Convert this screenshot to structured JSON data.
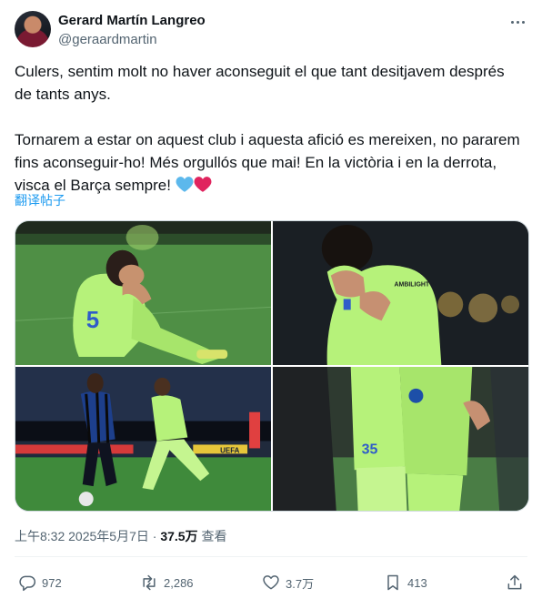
{
  "author": {
    "display_name": "Gerard Martín Langreo",
    "handle": "@geraardmartin"
  },
  "tweet": {
    "paragraph_1": "Culers, sentim molt no haver aconseguit el que tant desitjavem després de tants anys.",
    "paragraph_2": "Tornarem a estar on aquest club i aquesta afició es mereixen, no pararem fins aconseguir-ho! Més orgullós que mai! En la victòria i en la derrota, visca el Barça sempre!",
    "translate_label": "翻译帖子"
  },
  "media": {
    "photo_1_number": "5",
    "photo_2_sponsor": "AMBILIGHT tv",
    "photo_3_board": "UEFA",
    "photo_4_number": "35"
  },
  "meta": {
    "time": "上午8:32",
    "separator": "·",
    "date": "2025年5月7日",
    "views_count": "37.5万",
    "views_label": "查看"
  },
  "actions": {
    "replies": "972",
    "retweets": "2,286",
    "likes": "3.7万",
    "bookmarks": "413"
  },
  "colors": {
    "link": "#1d9bf0",
    "secondary_text": "#536471",
    "heart_blue": "#5cb8ec",
    "heart_red": "#e0245e",
    "kit_green": "#b6f27a"
  }
}
